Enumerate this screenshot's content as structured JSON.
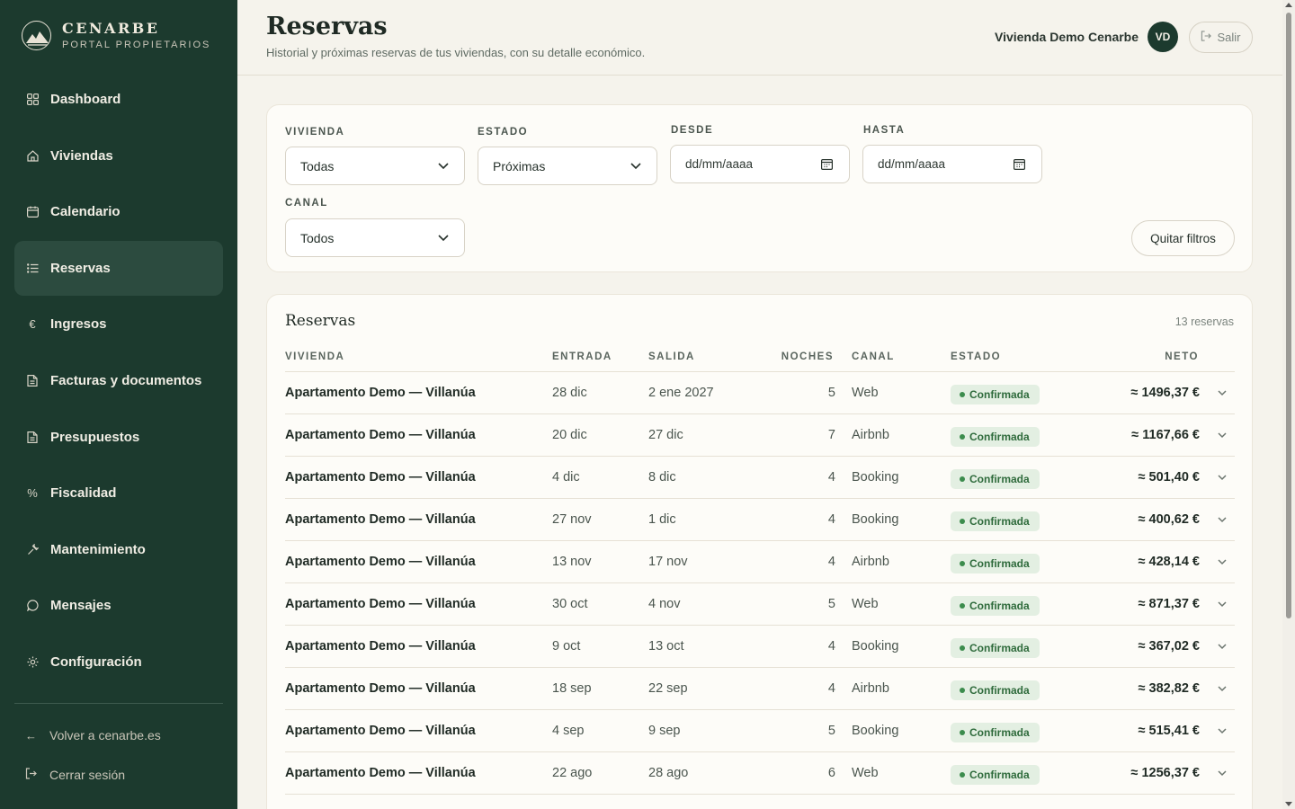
{
  "brand": {
    "name": "CENARBE",
    "subtitle": "PORTAL PROPIETARIOS"
  },
  "sidebar": {
    "items": [
      {
        "label": "Dashboard",
        "icon": "grid-icon"
      },
      {
        "label": "Viviendas",
        "icon": "home-icon"
      },
      {
        "label": "Calendario",
        "icon": "calendar-icon"
      },
      {
        "label": "Reservas",
        "icon": "list-icon",
        "active": true
      },
      {
        "label": "Ingresos",
        "icon": "euro-icon"
      },
      {
        "label": "Facturas y documentos",
        "icon": "document-icon"
      },
      {
        "label": "Presupuestos",
        "icon": "document-icon"
      },
      {
        "label": "Fiscalidad",
        "icon": "percent-icon"
      },
      {
        "label": "Mantenimiento",
        "icon": "wrench-icon"
      },
      {
        "label": "Mensajes",
        "icon": "message-icon"
      },
      {
        "label": "Configuración",
        "icon": "gear-icon"
      }
    ],
    "back_link": "Volver a cenarbe.es",
    "logout": "Cerrar sesión"
  },
  "header": {
    "title": "Reservas",
    "subtitle": "Historial y próximas reservas de tus viviendas, con su detalle económico.",
    "user_name": "Vivienda Demo Cenarbe",
    "avatar_initials": "VD",
    "logout_label": "Salir"
  },
  "filters": {
    "vivienda": {
      "label": "VIVIENDA",
      "value": "Todas"
    },
    "estado": {
      "label": "ESTADO",
      "value": "Próximas"
    },
    "desde": {
      "label": "DESDE",
      "placeholder": "dd/mm/aaaa"
    },
    "hasta": {
      "label": "HASTA",
      "placeholder": "dd/mm/aaaa"
    },
    "canal": {
      "label": "CANAL",
      "value": "Todos"
    },
    "clear_label": "Quitar filtros"
  },
  "results": {
    "title": "Reservas",
    "count": "13 reservas",
    "columns": {
      "vivienda": "VIVIENDA",
      "entrada": "ENTRADA",
      "salida": "SALIDA",
      "noches": "NOCHES",
      "canal": "CANAL",
      "estado": "ESTADO",
      "neto": "NETO"
    },
    "rows": [
      {
        "vivienda": "Apartamento Demo — Villanúa",
        "entrada": "28 dic",
        "salida": "2 ene 2027",
        "noches": "5",
        "canal": "Web",
        "estado": "Confirmada",
        "neto": "≈ 1496,37 €"
      },
      {
        "vivienda": "Apartamento Demo — Villanúa",
        "entrada": "20 dic",
        "salida": "27 dic",
        "noches": "7",
        "canal": "Airbnb",
        "estado": "Confirmada",
        "neto": "≈ 1167,66 €"
      },
      {
        "vivienda": "Apartamento Demo — Villanúa",
        "entrada": "4 dic",
        "salida": "8 dic",
        "noches": "4",
        "canal": "Booking",
        "estado": "Confirmada",
        "neto": "≈ 501,40 €"
      },
      {
        "vivienda": "Apartamento Demo — Villanúa",
        "entrada": "27 nov",
        "salida": "1 dic",
        "noches": "4",
        "canal": "Booking",
        "estado": "Confirmada",
        "neto": "≈ 400,62 €"
      },
      {
        "vivienda": "Apartamento Demo — Villanúa",
        "entrada": "13 nov",
        "salida": "17 nov",
        "noches": "4",
        "canal": "Airbnb",
        "estado": "Confirmada",
        "neto": "≈ 428,14 €"
      },
      {
        "vivienda": "Apartamento Demo — Villanúa",
        "entrada": "30 oct",
        "salida": "4 nov",
        "noches": "5",
        "canal": "Web",
        "estado": "Confirmada",
        "neto": "≈ 871,37 €"
      },
      {
        "vivienda": "Apartamento Demo — Villanúa",
        "entrada": "9 oct",
        "salida": "13 oct",
        "noches": "4",
        "canal": "Booking",
        "estado": "Confirmada",
        "neto": "≈ 367,02 €"
      },
      {
        "vivienda": "Apartamento Demo — Villanúa",
        "entrada": "18 sep",
        "salida": "22 sep",
        "noches": "4",
        "canal": "Airbnb",
        "estado": "Confirmada",
        "neto": "≈ 382,82 €"
      },
      {
        "vivienda": "Apartamento Demo — Villanúa",
        "entrada": "4 sep",
        "salida": "9 sep",
        "noches": "5",
        "canal": "Booking",
        "estado": "Confirmada",
        "neto": "≈ 515,41 €"
      },
      {
        "vivienda": "Apartamento Demo — Villanúa",
        "entrada": "22 ago",
        "salida": "28 ago",
        "noches": "6",
        "canal": "Web",
        "estado": "Confirmada",
        "neto": "≈ 1256,37 €"
      }
    ]
  },
  "colors": {
    "sidebar_bg": "#1c3a2e",
    "sidebar_active": "#2c4b3f",
    "page_bg": "#f5f3ec",
    "badge_bg": "#e3efe2",
    "badge_text": "#2f6b3c"
  }
}
